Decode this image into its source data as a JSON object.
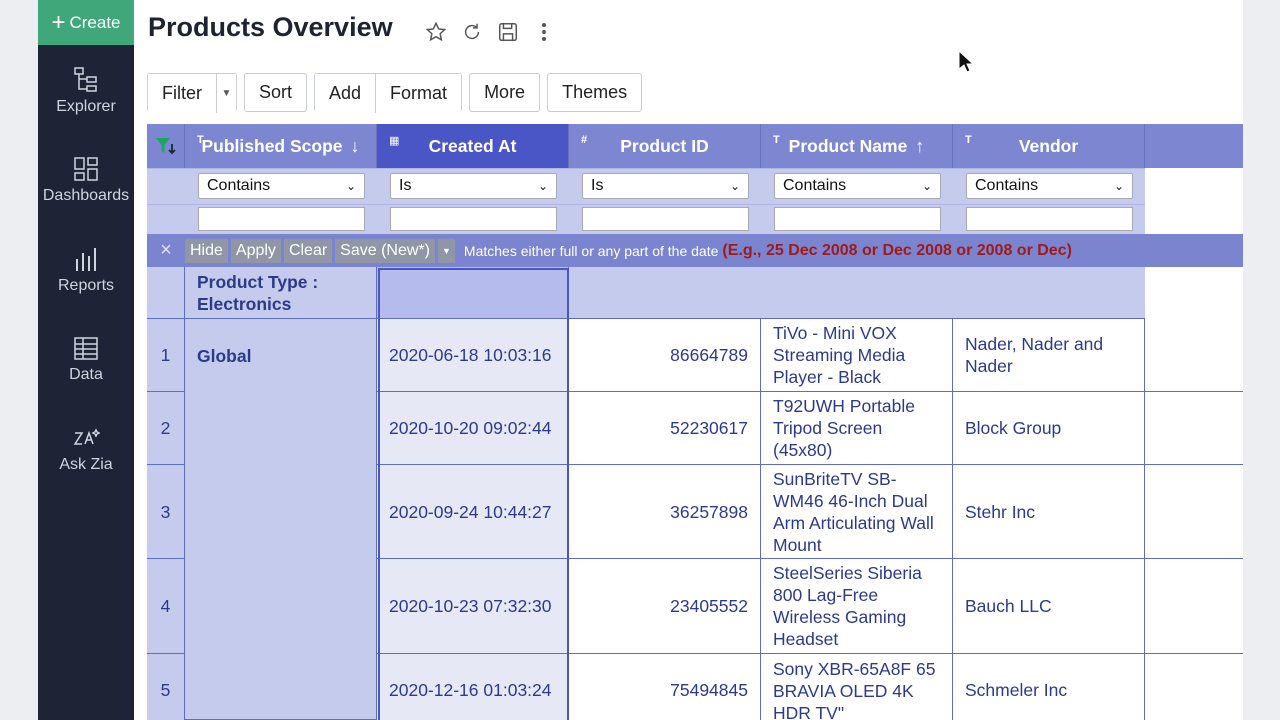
{
  "sidebar": {
    "create_label": "Create",
    "items": [
      {
        "label": "Explorer",
        "icon": "explorer-icon"
      },
      {
        "label": "Dashboards",
        "icon": "dashboards-icon"
      },
      {
        "label": "Reports",
        "icon": "reports-icon"
      },
      {
        "label": "Data",
        "icon": "data-icon"
      },
      {
        "label": "Ask Zia",
        "icon": "ask-zia-icon"
      }
    ]
  },
  "header": {
    "title": "Products Overview"
  },
  "toolbar": {
    "filter": "Filter",
    "sort": "Sort",
    "add": "Add",
    "format": "Format",
    "more": "More",
    "themes": "Themes"
  },
  "table": {
    "columns": [
      {
        "label": "Published Scope",
        "type_icon": "T",
        "sort": "↓"
      },
      {
        "label": "Created At",
        "type_icon": "▦",
        "sort": ""
      },
      {
        "label": "Product ID",
        "type_icon": "#",
        "sort": ""
      },
      {
        "label": "Product Name",
        "type_icon": "T",
        "sort": "↑"
      },
      {
        "label": "Vendor",
        "type_icon": "T",
        "sort": ""
      }
    ],
    "filters": [
      "Contains",
      "Is",
      "Is",
      "Contains",
      "Contains"
    ],
    "filter_bar": {
      "hide": "Hide",
      "apply": "Apply",
      "clear": "Clear",
      "save": "Save (New*)",
      "hint": "Matches either full or any part of the date",
      "example": "(E.g., 25 Dec 2008 or Dec 2008 or 2008 or Dec)"
    },
    "group_label": "Product Type : Electronics",
    "scope_group": "Global",
    "rows": [
      {
        "num": "1",
        "created": "2020-06-18 10:03:16",
        "id": "86664789",
        "name": "TiVo - Mini VOX Streaming Media Player - Black",
        "vendor": "Nader, Nader and Nader"
      },
      {
        "num": "2",
        "created": "2020-10-20 09:02:44",
        "id": "52230617",
        "name": "T92UWH Portable Tripod Screen (45x80)",
        "vendor": "Block Group"
      },
      {
        "num": "3",
        "created": "2020-09-24 10:44:27",
        "id": "36257898",
        "name": "SunBriteTV SB-WM46 46-Inch Dual Arm Articulating Wall Mount",
        "vendor": "Stehr Inc"
      },
      {
        "num": "4",
        "created": "2020-10-23 07:32:30",
        "id": "23405552",
        "name": "SteelSeries Siberia 800 Lag-Free Wireless Gaming Headset",
        "vendor": "Bauch LLC"
      },
      {
        "num": "5",
        "created": "2020-12-16 01:03:24",
        "id": "75494845",
        "name": "Sony XBR-65A8F 65 BRAVIA OLED 4K HDR TV\"",
        "vendor": "Schmeler Inc"
      }
    ]
  }
}
